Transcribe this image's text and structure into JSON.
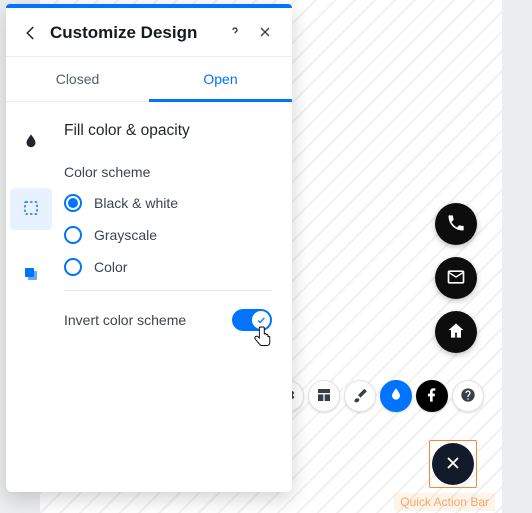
{
  "panel": {
    "title": "Customize Design",
    "tabs": {
      "closed": "Closed",
      "open": "Open"
    },
    "section_title": "Fill color & opacity",
    "color_scheme": {
      "label": "Color scheme",
      "options": {
        "bw": "Black & white",
        "gray": "Grayscale",
        "color": "Color"
      }
    },
    "invert": {
      "label": "Invert color scheme"
    }
  },
  "qab_label": "Quick Action Bar"
}
